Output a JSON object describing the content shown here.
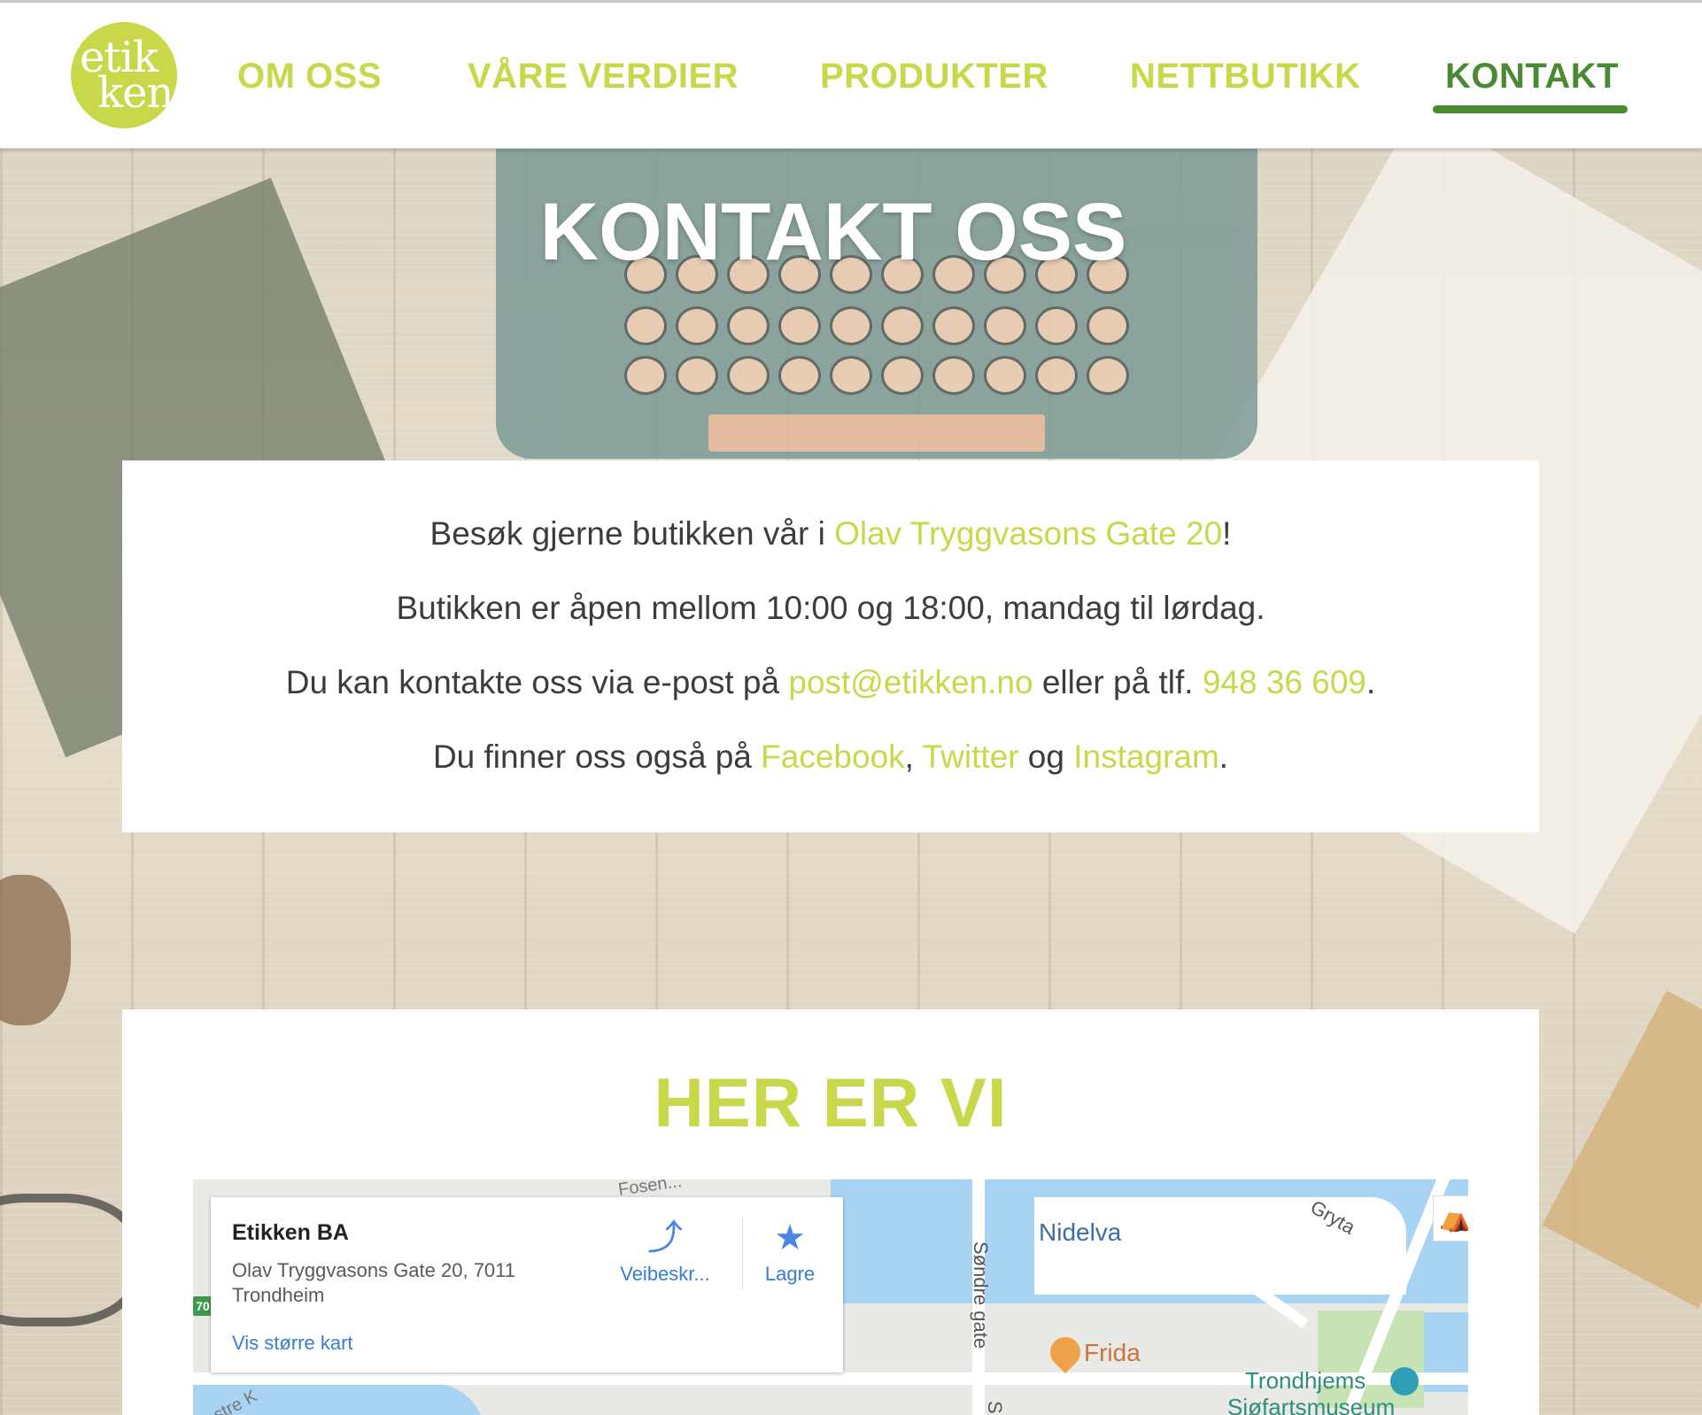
{
  "brand": {
    "logo_line1": "etik",
    "logo_line2": "ken",
    "accent": "#c8d84a",
    "active": "#4a8a32"
  },
  "nav": {
    "items": [
      {
        "label": "OM OSS"
      },
      {
        "label": "VÅRE VERDIER"
      },
      {
        "label": "PRODUKTER"
      },
      {
        "label": "NETTBUTIKK"
      },
      {
        "label": "KONTAKT",
        "active": true
      }
    ]
  },
  "hero": {
    "title": "KONTAKT OSS"
  },
  "info": {
    "line1_pre": "Besøk gjerne butikken vår i ",
    "line1_link": "Olav Tryggvasons Gate 20",
    "line1_post": "!",
    "line2": "Butikken er åpen mellom 10:00 og 18:00, mandag til lørdag.",
    "line3_pre": "Du kan kontakte oss via e-post på ",
    "line3_email": "post@etikken.no",
    "line3_mid": " eller på tlf. ",
    "line3_phone": "948 36 609",
    "line3_post": ".",
    "line4_pre": "Du finner oss også på ",
    "line4_facebook": "Facebook",
    "line4_comma": ", ",
    "line4_twitter": "Twitter",
    "line4_og": " og ",
    "line4_instagram": "Instagram",
    "line4_post": "."
  },
  "map_section": {
    "heading": "HER ER VI",
    "place": {
      "name": "Etikken BA",
      "address_line1": "Olav Tryggvasons Gate 20, 7011",
      "address_line2": "Trondheim",
      "larger_map": "Vis større kart",
      "directions_label": "Veibeskr...",
      "save_label": "Lagre",
      "directions_icon": "directions-icon",
      "save_icon": "star-icon"
    },
    "labels": {
      "nidelva": "Nidelva",
      "sondre_gate": "Søndre gate",
      "gryta": "Gryta",
      "fosen": "Fosen...",
      "vestre": "Vestre K",
      "so": "Sø",
      "frida": "Frida",
      "museum_line1": "Trondhjems",
      "museum_line2": "Sjøfartsmuseum",
      "route": "70"
    }
  }
}
